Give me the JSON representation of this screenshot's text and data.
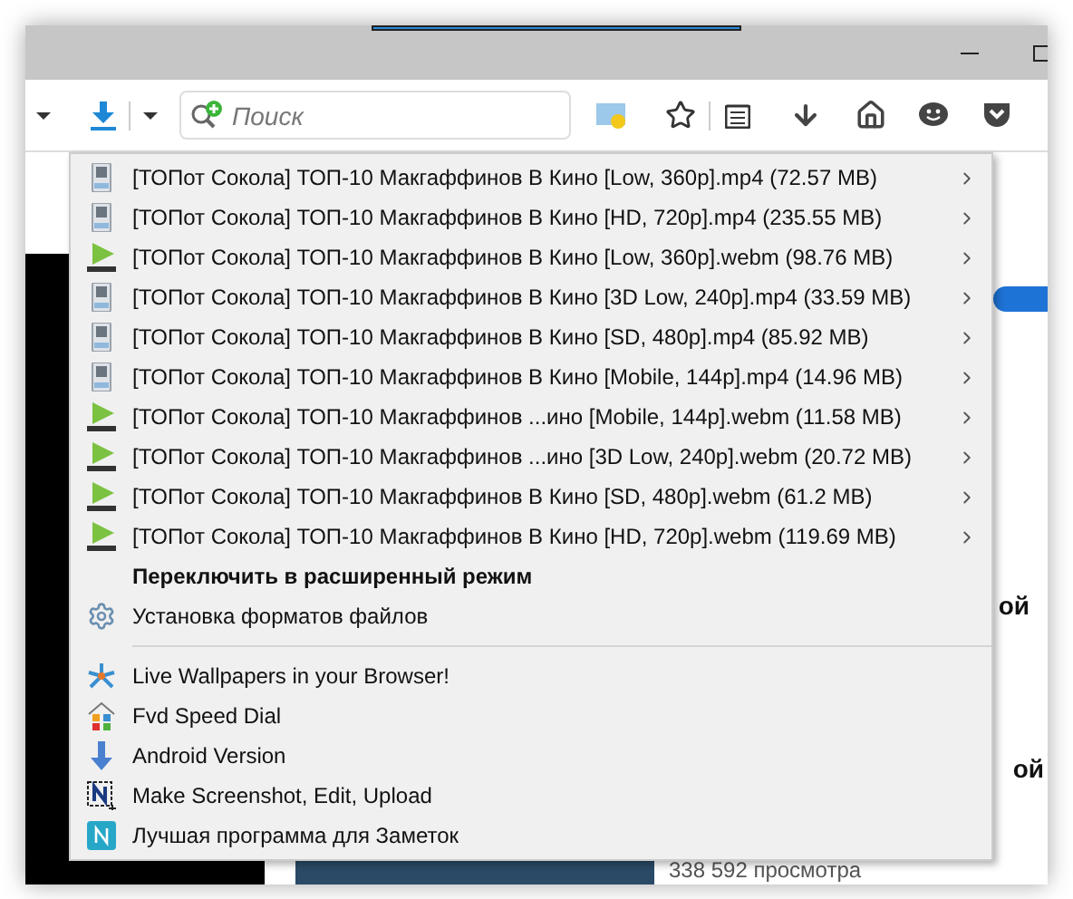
{
  "toolbar": {
    "search": {
      "placeholder": "Поиск"
    }
  },
  "menu": {
    "downloads": [
      {
        "kind": "mp4",
        "label": "[ТОПот Сокола] ТОП-10 Макгаффинов В Кино [Low, 360p].mp4 (72.57 MB)"
      },
      {
        "kind": "mp4",
        "label": "[ТОПот Сокола] ТОП-10 Макгаффинов В Кино [HD, 720p].mp4 (235.55 MB)"
      },
      {
        "kind": "webm",
        "label": "[ТОПот Сокола] ТОП-10 Макгаффинов В Кино [Low, 360p].webm (98.76 MB)"
      },
      {
        "kind": "mp4",
        "label": "[ТОПот Сокола] ТОП-10 Макгаффинов В Кино [3D Low, 240p].mp4 (33.59 MB)"
      },
      {
        "kind": "mp4",
        "label": "[ТОПот Сокола] ТОП-10 Макгаффинов В Кино [SD, 480p].mp4 (85.92 MB)"
      },
      {
        "kind": "mp4",
        "label": "[ТОПот Сокола] ТОП-10 Макгаффинов В Кино [Mobile, 144p].mp4 (14.96 MB)"
      },
      {
        "kind": "webm",
        "label": "[ТОПот Сокола] ТОП-10 Макгаффинов ...ино [Mobile, 144p].webm (11.58 MB)"
      },
      {
        "kind": "webm",
        "label": "[ТОПот Сокола] ТОП-10 Макгаффинов ...ино [3D Low, 240p].webm (20.72 MB)"
      },
      {
        "kind": "webm",
        "label": "[ТОПот Сокола] ТОП-10 Макгаффинов В Кино [SD, 480p].webm (61.2 MB)"
      },
      {
        "kind": "webm",
        "label": "[ТОПот Сокола] ТОП-10 Макгаффинов В Кино [HD, 720p].webm (119.69 MB)"
      }
    ],
    "mode_switch": "Переключить в расширенный режим",
    "settings": "Установка форматов файлов",
    "extensions": [
      {
        "kind": "wallpapers",
        "label": "Live Wallpapers in your Browser!"
      },
      {
        "kind": "speeddial",
        "label": "Fvd Speed Dial"
      },
      {
        "kind": "android",
        "label": "Android Version"
      },
      {
        "kind": "screenshot",
        "label": "Make Screenshot, Edit, Upload"
      },
      {
        "kind": "notes",
        "label": "Лучшая программа для Заметок"
      }
    ]
  },
  "page": {
    "toggle": {
      "on": true
    },
    "partial_texts": [
      "ой",
      "ой"
    ],
    "views": "338 592 просмотра"
  }
}
